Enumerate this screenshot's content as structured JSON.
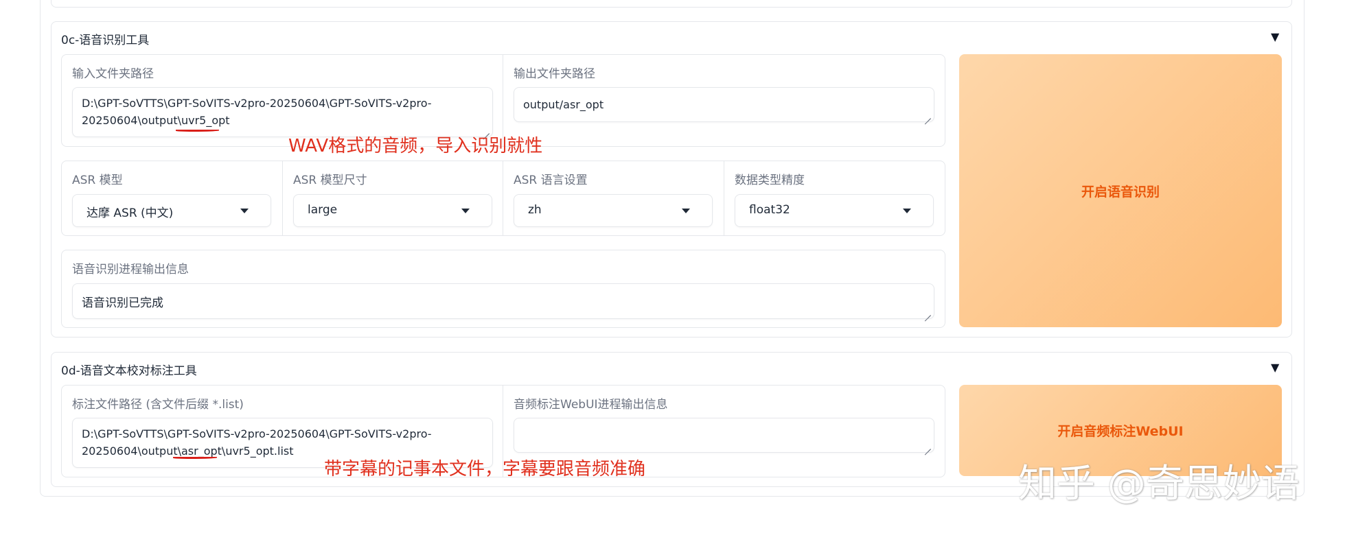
{
  "section_asr": {
    "title": "0c-语音识别工具",
    "input_label": "输入文件夹路径",
    "input_value": "D:\\GPT-SoVTTS\\GPT-SoVITS-v2pro-20250604\\GPT-SoVITS-v2pro-\n20250604\\output\\uvr5_opt",
    "output_label": "输出文件夹路径",
    "output_value": "output/asr_opt",
    "model_label": "ASR 模型",
    "model_value": "达摩 ASR (中文)",
    "size_label": "ASR 模型尺寸",
    "size_value": "large",
    "lang_label": "ASR 语言设置",
    "lang_value": "zh",
    "dtype_label": "数据类型精度",
    "dtype_value": "float32",
    "progress_label": "语音识别进程输出信息",
    "progress_value": "语音识别已完成",
    "start_button": "开启语音识别"
  },
  "section_label": {
    "title": "0d-语音文本校对标注工具",
    "list_label": "标注文件路径 (含文件后缀 *.list)",
    "list_value": "D:\\GPT-SoVTTS\\GPT-SoVITS-v2pro-20250604\\GPT-SoVITS-v2pro-\n20250604\\output\\asr_opt\\uvr5_opt.list",
    "webui_label": "音频标注WebUI进程输出信息",
    "webui_value": "",
    "start_button": "开启音频标注WebUI"
  },
  "annotations": {
    "note1": "WAV格式的音频，导入识别就性",
    "note2": "带字幕的记事本文件，字幕要跟音频准确"
  },
  "watermark": "知乎 @奇思妙语",
  "colors": {
    "accent": "#ea580c",
    "button_gradient_start": "#fed7aa",
    "button_gradient_end": "#fdba74",
    "annotation": "#e0301e",
    "border": "#e5e7eb"
  }
}
